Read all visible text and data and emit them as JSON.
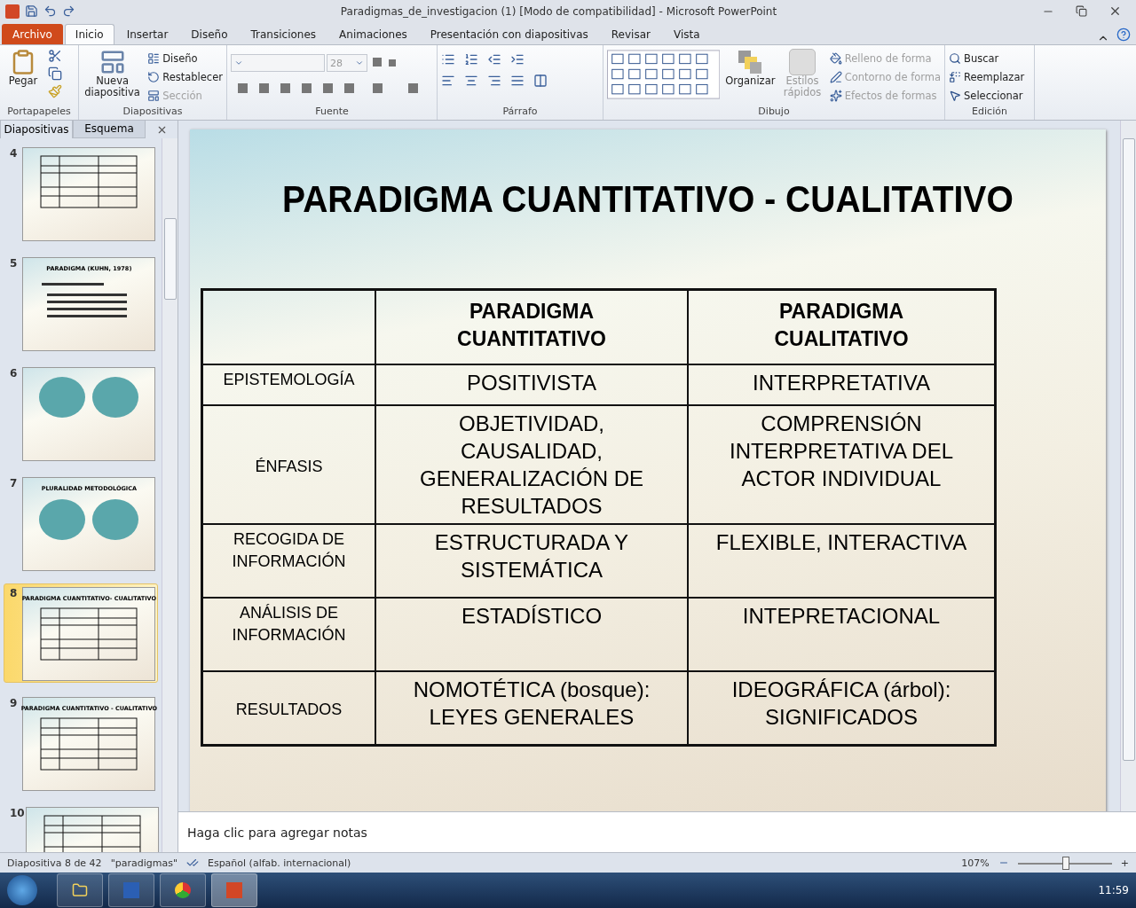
{
  "window": {
    "title": "Paradigmas_de_investigacion (1) [Modo de compatibilidad]  -  Microsoft PowerPoint"
  },
  "ribbon_tabs": [
    {
      "label": "Archivo",
      "kind": "file",
      "selected": false
    },
    {
      "label": "Inicio",
      "kind": "tab",
      "selected": true
    },
    {
      "label": "Insertar",
      "kind": "tab",
      "selected": false
    },
    {
      "label": "Diseño",
      "kind": "tab",
      "selected": false
    },
    {
      "label": "Transiciones",
      "kind": "tab",
      "selected": false
    },
    {
      "label": "Animaciones",
      "kind": "tab",
      "selected": false
    },
    {
      "label": "Presentación con diapositivas",
      "kind": "tab",
      "selected": false
    },
    {
      "label": "Revisar",
      "kind": "tab",
      "selected": false
    },
    {
      "label": "Vista",
      "kind": "tab",
      "selected": false
    }
  ],
  "clipboard": {
    "label": "Portapapeles",
    "paste": "Pegar"
  },
  "slides_group": {
    "label": "Diapositivas",
    "new_slide": "Nueva diapositiva",
    "items": [
      {
        "label": "Diseño",
        "disabled": false
      },
      {
        "label": "Restablecer",
        "disabled": false
      },
      {
        "label": "Sección",
        "disabled": true
      }
    ]
  },
  "font": {
    "label": "Fuente",
    "size": "28"
  },
  "paragraph": {
    "label": "Párrafo"
  },
  "drawing": {
    "label": "Dibujo",
    "arrange": "Organizar",
    "quick_styles": "Estilos rápidos",
    "items": [
      {
        "label": "Relleno de forma",
        "disabled": true
      },
      {
        "label": "Contorno de forma",
        "disabled": true
      },
      {
        "label": "Efectos de formas",
        "disabled": true
      }
    ]
  },
  "editing": {
    "label": "Edición",
    "items": [
      "Buscar",
      "Reemplazar",
      "Seleccionar"
    ]
  },
  "pane_tabs": [
    {
      "label": "Diapositivas",
      "selected": true
    },
    {
      "label": "Esquema",
      "selected": false
    }
  ],
  "thumbnails": [
    {
      "number": "4",
      "kind": "table",
      "selected": false
    },
    {
      "number": "5",
      "kind": "text",
      "title": "PARADIGMA  (KUHN,  1978)",
      "selected": false
    },
    {
      "number": "6",
      "kind": "circles",
      "selected": false
    },
    {
      "number": "7",
      "kind": "circles",
      "title": "PLURALIDAD METODOLÓGICA",
      "selected": false
    },
    {
      "number": "8",
      "kind": "table",
      "title": "PARADIGMA CUANTITATIVO- CUALITATIVO",
      "selected": true
    },
    {
      "number": "9",
      "kind": "table",
      "title": "PARADIGMA  CUANTITATIVO - CUALITATIVO",
      "selected": false
    },
    {
      "number": "10",
      "kind": "table",
      "selected": false
    }
  ],
  "slide": {
    "title": "PARADIGMA CUANTITATIVO - CUALITATIVO",
    "columns": [
      "PARADIGMA CUANTITATIVO",
      "PARADIGMA CUALITATIVO"
    ],
    "rows": [
      {
        "label": "EPISTEMOLOGÍA",
        "cells": [
          "POSITIVISTA",
          "INTERPRETATIVA"
        ]
      },
      {
        "label": "ÉNFASIS",
        "cells": [
          "OBJETIVIDAD, CAUSALIDAD, GENERALIZACIÓN DE RESULTADOS",
          "COMPRENSIÓN INTERPRETATIVA DEL ACTOR INDIVIDUAL"
        ]
      },
      {
        "label": "RECOGIDA DE INFORMACIÓN",
        "cells": [
          "ESTRUCTURADA Y SISTEMÁTICA",
          "FLEXIBLE, INTERACTIVA"
        ]
      },
      {
        "label": "ANÁLISIS DE INFORMACIÓN",
        "cells": [
          "ESTADÍSTICO",
          "INTEPRETACIONAL"
        ]
      },
      {
        "label": "RESULTADOS",
        "cells": [
          "NOMOTÉTICA (bosque): LEYES GENERALES",
          "IDEOGRÁFICA (árbol): SIGNIFICADOS"
        ]
      }
    ]
  },
  "notes": {
    "placeholder": "Haga clic para agregar notas"
  },
  "status_bar": {
    "slide": "Diapositiva 8 de 42",
    "theme": "\"paradigmas\"",
    "language": "Español (alfab. internacional)",
    "zoom": "107%",
    "level": 0.5,
    "zoom_in": "+"
  },
  "taskbar": {
    "clock": "11:59"
  }
}
